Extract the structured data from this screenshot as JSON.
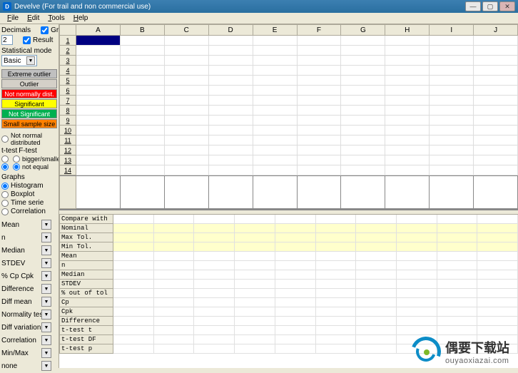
{
  "titlebar": {
    "icon": "D",
    "text": "Develve (For trail and non commercial use)"
  },
  "menubar": [
    "File",
    "Edit",
    "Tools",
    "Help"
  ],
  "left": {
    "decimals_label": "Decimals",
    "decimals_value": "2",
    "graph_chk": "Graph",
    "result_chk": "Result",
    "stat_mode_label": "Statistical mode",
    "stat_mode_value": "Basic",
    "color_btns": {
      "extreme": "Extreme outlier",
      "outlier": "Outlier",
      "notnorm": "Not normally dist.",
      "sig": "Significant",
      "notsig": "Not Significant",
      "small": "Small sample size"
    },
    "notnorm_label": "Not normal distributed",
    "ttest_label": "t-test",
    "ftest_label": "F-test",
    "bigger_label": "bigger/smaller",
    "notequal_label": "not equal",
    "graphs_label": "Graphs",
    "hist": "Histogram",
    "box": "Boxplot",
    "time": "Time serie",
    "corr": "Correlation",
    "stat_drops": [
      "Mean",
      "n",
      "Median",
      "STDEV",
      "% Cp Cpk",
      "Difference",
      "Diff mean",
      "Normality test",
      "Diff variation",
      "Correlation",
      "Min/Max",
      "none"
    ]
  },
  "columns": [
    "A",
    "B",
    "C",
    "D",
    "E",
    "F",
    "G",
    "H",
    "I",
    "J"
  ],
  "rows": [
    "1",
    "2",
    "3",
    "4",
    "5",
    "6",
    "7",
    "8",
    "9",
    "10",
    "11",
    "12",
    "13",
    "14"
  ],
  "stats_rows": [
    {
      "label": "Compare with",
      "yellow": false,
      "sel": true
    },
    {
      "label": "Nominal",
      "yellow": true
    },
    {
      "label": "Max Tol.",
      "yellow": true
    },
    {
      "label": "Min Tol.",
      "yellow": true
    },
    {
      "label": "Mean",
      "yellow": false
    },
    {
      "label": "n",
      "yellow": false
    },
    {
      "label": "Median",
      "yellow": false
    },
    {
      "label": "STDEV",
      "yellow": false
    },
    {
      "label": "% out of tol",
      "yellow": false
    },
    {
      "label": "Cp",
      "yellow": false
    },
    {
      "label": "Cpk",
      "yellow": false
    },
    {
      "label": "Difference",
      "yellow": false
    },
    {
      "label": "t-test t",
      "yellow": false
    },
    {
      "label": "t-test DF",
      "yellow": false
    },
    {
      "label": "t-test p",
      "yellow": false
    }
  ],
  "watermark": {
    "cn": "偶要下载站",
    "en": "ouyaoxiazai.com"
  }
}
